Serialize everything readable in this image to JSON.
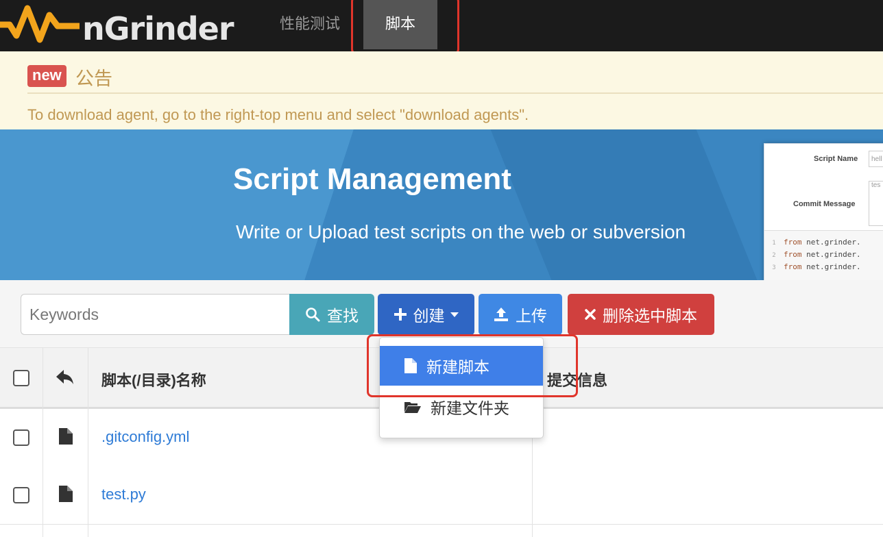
{
  "navbar": {
    "brand": "nGrinder",
    "items": [
      {
        "label": "性能测试"
      },
      {
        "label": "脚本"
      }
    ]
  },
  "notice": {
    "badge": "new",
    "title": "公告",
    "message": "To download agent, go to the right-top menu and select \"download agents\"."
  },
  "banner": {
    "title": "Script Management",
    "subtitle": "Write or Upload test scripts on the web or subversion",
    "preview": {
      "script_name_label": "Script Name",
      "script_name_value": "hell",
      "commit_message_label": "Commit Message",
      "commit_message_value": "tes",
      "code_lines": [
        {
          "num": "1",
          "kw": "from",
          "text": " net.grinder."
        },
        {
          "num": "2",
          "kw": "from",
          "text": " net.grinder."
        },
        {
          "num": "3",
          "kw": "from",
          "text": " net.grinder."
        }
      ]
    }
  },
  "toolbar": {
    "search_placeholder": "Keywords",
    "search_label": "查找",
    "create_label": "创建",
    "upload_label": "上传",
    "delete_label": "删除选中脚本"
  },
  "create_menu": {
    "new_script": "新建脚本",
    "new_folder": "新建文件夹"
  },
  "table": {
    "headers": {
      "name": "脚本(/目录)名称",
      "commit_message": "提交信息"
    },
    "rows": [
      {
        "name": ".gitconfig.yml"
      },
      {
        "name": "test.py"
      }
    ]
  },
  "colors": {
    "navbar": "#1b1b1b",
    "highlight": "#e0352b",
    "banner": "#3b86c1",
    "search_button": "#49a6b7",
    "create_button": "#2f66c4",
    "upload_button": "#3f88e4",
    "delete_button": "#d0403e",
    "link": "#2e7bd6"
  }
}
